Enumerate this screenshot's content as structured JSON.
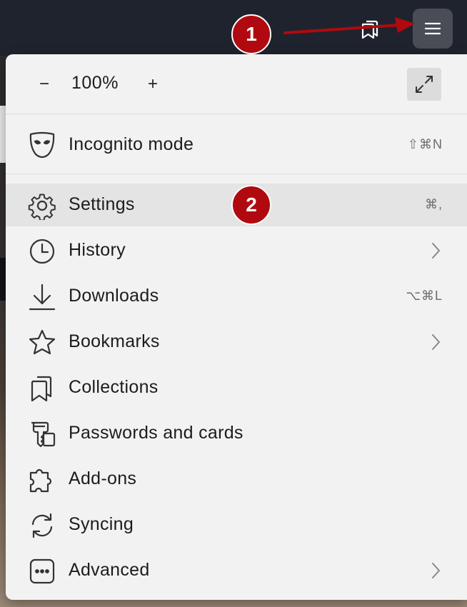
{
  "toolbar": {
    "collections_icon": "bookmark-stack-icon",
    "menu_icon": "hamburger-icon"
  },
  "zoom": {
    "minus": "−",
    "value": "100%",
    "plus": "+",
    "fullscreen_icon": "expand-icon"
  },
  "menu": {
    "items": [
      {
        "label": "Incognito mode",
        "icon": "incognito-mask-icon",
        "shortcut": "⇧⌘N"
      },
      {
        "label": "Settings",
        "icon": "gear-icon",
        "shortcut": "⌘,"
      },
      {
        "label": "History",
        "icon": "clock-icon",
        "submenu": true
      },
      {
        "label": "Downloads",
        "icon": "download-icon",
        "shortcut": "⌥⌘L"
      },
      {
        "label": "Bookmarks",
        "icon": "star-icon",
        "submenu": true
      },
      {
        "label": "Collections",
        "icon": "collections-icon"
      },
      {
        "label": "Passwords and cards",
        "icon": "key-card-icon"
      },
      {
        "label": "Add-ons",
        "icon": "puzzle-icon"
      },
      {
        "label": "Syncing",
        "icon": "sync-icon"
      },
      {
        "label": "Advanced",
        "icon": "more-dots-icon",
        "submenu": true
      }
    ]
  },
  "annotations": {
    "badge_1": "1",
    "badge_2": "2",
    "color": "#b00a10"
  }
}
